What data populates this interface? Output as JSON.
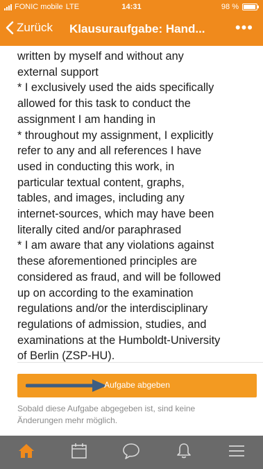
{
  "status_bar": {
    "carrier": "FONIC mobile",
    "network": "LTE",
    "time": "14:31",
    "battery": "98 %"
  },
  "nav": {
    "back_label": "Zurück",
    "title": "Klausuraufgabe: Hand...",
    "more_label": "•••"
  },
  "content": {
    "declaration_text": "written by myself and without any\nexternal support\n* I exclusively used the aids specifically\nallowed for this task to conduct the\nassignment I am handing in\n* throughout my assignment, I explicitly\nrefer to any and all references I have\nused in conducting this work, in\nparticular textual content, graphs,\ntables, and images, including any\ninternet-sources, which may have been\nliterally cited and/or paraphrased\n* I am aware that any violations against\nthese aforementioned principles are\nconsidered as fraud, and will be followed\nup on according to the examination\nregulations and/or the interdisciplinary\nregulations of admission, studies, and\nexaminations at the Humboldt-University\nof Berlin (ZSP-HU)."
  },
  "submit": {
    "label": "Aufgabe abgeben",
    "note": "Sobald diese Aufgabe abgegeben ist, sind keine\nÄnderungen mehr möglich."
  },
  "tabbar": {
    "items": [
      {
        "icon": "home-icon",
        "active": true
      },
      {
        "icon": "calendar-icon",
        "active": false
      },
      {
        "icon": "chat-icon",
        "active": false
      },
      {
        "icon": "bell-icon",
        "active": false
      },
      {
        "icon": "menu-icon",
        "active": false
      }
    ]
  },
  "colors": {
    "brand": "#f08a1c",
    "button": "#f39a21",
    "tabbar": "#6a6a6a",
    "active_tab": "#f08a1c",
    "annotation_arrow": "#3e5e82"
  }
}
